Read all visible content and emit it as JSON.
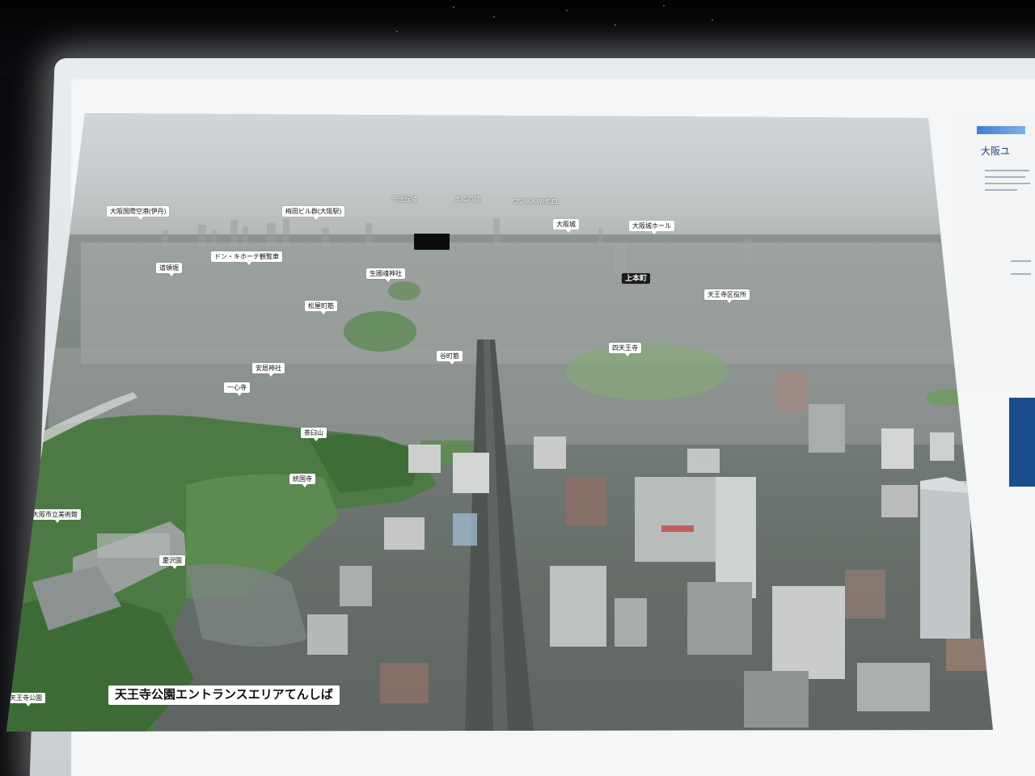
{
  "scene": {
    "description_colors": {
      "panel_light": "#e9ecef",
      "label_bg": "#ffffff",
      "night": "#050608"
    }
  },
  "labels": {
    "itami": "大阪国際空港(伊丹)",
    "umeda": "梅田ビル群(大阪駅)",
    "senri": "千里丘陵",
    "taiyo": "太陽の塔",
    "osaka_wheel": "OSAKA WHEEL",
    "osaka_castle": "大阪城",
    "castle_hall": "大阪城ホール",
    "dotonbori": "道頓堀",
    "donki": "ドン・キホーテ観覧車",
    "ikukunitama": "生國魂神社",
    "uehonmachi": "上本町",
    "tennoji_ward": "天王寺区役所",
    "matsuyamachi": "松屋町筋",
    "tanimachi": "谷町筋",
    "shitennoji": "四天王寺",
    "yasui": "安居神社",
    "isshinji": "一心寺",
    "chausuyama": "茶臼山",
    "tokokuji": "統国寺",
    "art_museum": "大阪市立美術館",
    "keitakuen": "慶沢園",
    "tennoji_park": "天王寺公園",
    "tenshiba": "天王寺公園エントランスエリアてんしば"
  },
  "side_panel": {
    "title": "大阪ユ"
  }
}
